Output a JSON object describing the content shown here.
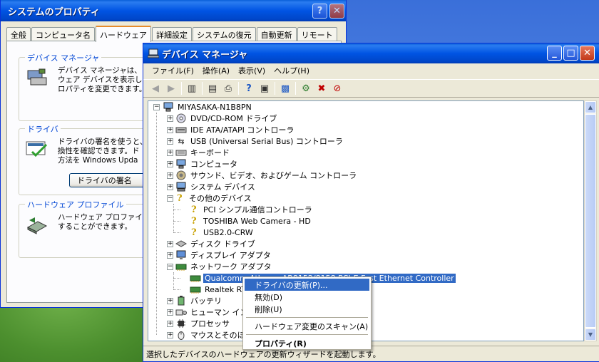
{
  "system_properties": {
    "title": "システムのプロパティ",
    "help_button": "?",
    "close_button": "✕",
    "tabs": [
      "全般",
      "コンピュータ名",
      "ハードウェア",
      "詳細設定",
      "システムの復元",
      "自動更新",
      "リモート"
    ],
    "active_tab": "ハードウェア",
    "groups": {
      "device_manager": {
        "label": "デバイス マネージャ",
        "text": "デバイス マネージャは、\nウェア デバイスを表示し\nロパティを変更できます。"
      },
      "driver": {
        "label": "ドライバ",
        "text": "ドライバの署名を使うと、\n換性を確認できます。ド\n方法を Windows Upda",
        "button": "ドライバの署名"
      },
      "hw_profile": {
        "label": "ハードウェア プロファイル",
        "text": "ハードウェア プロファイル\nすることができます。"
      }
    }
  },
  "device_manager": {
    "title": "デバイス マネージャ",
    "window_buttons": {
      "minimize": "_",
      "maximize": "□",
      "close": "✕"
    },
    "menu": [
      "ファイル(F)",
      "操作(A)",
      "表示(V)",
      "ヘルプ(H)"
    ],
    "toolbar_icons": [
      "back-arrow-icon",
      "forward-arrow-icon",
      "show-hide-tree-icon",
      "properties-icon",
      "print-icon",
      "help-icon",
      "view-icon",
      "monitor-icon",
      "scan-hardware-icon",
      "uninstall-icon",
      "disable-icon"
    ],
    "root": "MIYASAKA-N1B8PN",
    "tree": [
      {
        "label": "DVD/CD-ROM ドライブ",
        "icon": "cdrom-icon",
        "expanded": false
      },
      {
        "label": "IDE ATA/ATAPI コントローラ",
        "icon": "ide-controller-icon",
        "expanded": false
      },
      {
        "label": "USB (Universal Serial Bus) コントローラ",
        "icon": "usb-icon",
        "expanded": false
      },
      {
        "label": "キーボード",
        "icon": "keyboard-icon",
        "expanded": false
      },
      {
        "label": "コンピュータ",
        "icon": "computer-icon",
        "expanded": false
      },
      {
        "label": "サウンド、ビデオ、およびゲーム コントローラ",
        "icon": "sound-icon",
        "expanded": false
      },
      {
        "label": "システム デバイス",
        "icon": "system-device-icon",
        "expanded": false
      },
      {
        "label": "その他のデバイス",
        "icon": "unknown-device-icon",
        "expanded": true,
        "children": [
          "PCI シンプル通信コントローラ",
          "TOSHIBA Web Camera - HD",
          "USB2.0-CRW"
        ]
      },
      {
        "label": "ディスク ドライブ",
        "icon": "disk-drive-icon",
        "expanded": false
      },
      {
        "label": "ディスプレイ アダプタ",
        "icon": "display-adapter-icon",
        "expanded": false
      },
      {
        "label": "ネットワーク アダプタ",
        "icon": "network-adapter-icon",
        "expanded": true,
        "children": [
          "Qualcomm Atheros AR8152/8158 PCI-E Fast Ethernet Controller",
          "Realtek RTL8168/8111 PCI-E NIC"
        ]
      },
      {
        "label": "バッテリ",
        "icon": "battery-icon",
        "expanded": false
      },
      {
        "label": "ヒューマン インタ",
        "icon": "hid-icon",
        "expanded": false
      },
      {
        "label": "プロセッサ",
        "icon": "processor-icon",
        "expanded": false
      },
      {
        "label": "マウスとそのほか",
        "icon": "mouse-icon",
        "expanded": false
      }
    ],
    "selected_item": "Qualcomm Atheros AR8152/8158 PCI-E Fast Ethernet Controller",
    "status": "選択したデバイスのハードウェアの更新ウィザードを起動します。"
  },
  "context_menu": {
    "items": [
      {
        "label": "ドライバの更新(P)...",
        "highlighted": true
      },
      {
        "label": "無効(D)"
      },
      {
        "label": "削除(U)"
      },
      {
        "separator": true
      },
      {
        "label": "ハードウェア変更のスキャン(A)"
      },
      {
        "separator": true
      },
      {
        "label": "プロパティ(R)",
        "bold": true
      }
    ]
  },
  "colors": {
    "title_blue": "#0054e3",
    "selection": "#316ac5",
    "dialog_bg": "#ece9d8",
    "tab_accent": "#e68b2c"
  }
}
